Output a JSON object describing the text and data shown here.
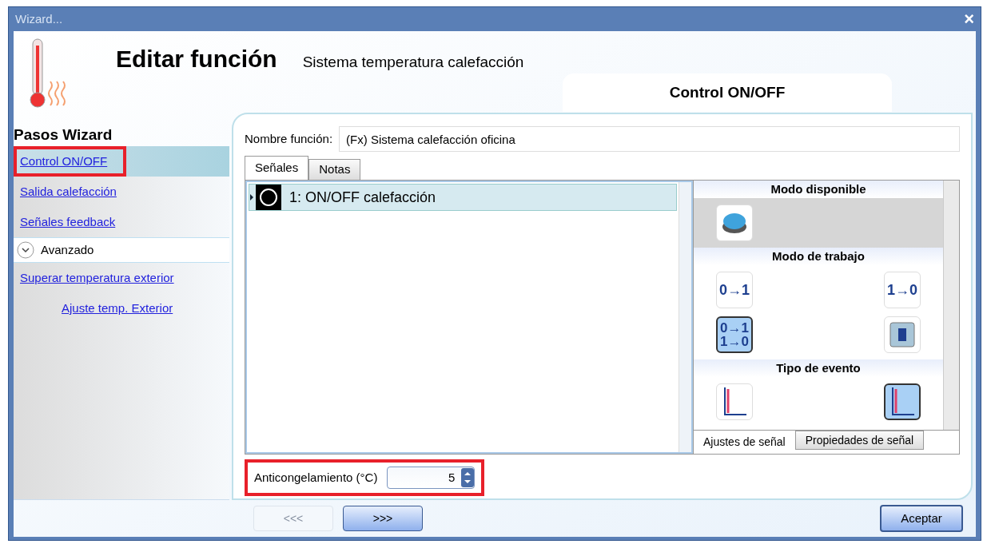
{
  "window": {
    "title": "Wizard...",
    "close": "×"
  },
  "header": {
    "title": "Editar función",
    "subtitle": "Sistema temperatura calefacción",
    "tab": "Control ON/OFF"
  },
  "sidebar": {
    "title": "Pasos Wizard",
    "items": [
      {
        "kind": "link",
        "label": "Control ON/OFF",
        "selected": true,
        "annotated": true
      },
      {
        "kind": "link",
        "label": "Salida calefacción",
        "selected": false
      },
      {
        "kind": "link",
        "label": "Señales feedback",
        "selected": false
      },
      {
        "kind": "group",
        "label": "Avanzado",
        "expanded": true,
        "selected": false
      },
      {
        "kind": "link",
        "label": "Superar temperatura exterior",
        "selected": false
      },
      {
        "kind": "sublink",
        "label": "Ajuste temp. Exterior",
        "selected": false
      }
    ]
  },
  "name_field": {
    "label": "Nombre función:",
    "value": "(Fx) Sistema calefacción oficina"
  },
  "tabs": [
    {
      "label": "Señales",
      "selected": true
    },
    {
      "label": "Notas",
      "selected": false
    }
  ],
  "signals": [
    {
      "label": "1: ON/OFF calefacción",
      "selected": true
    }
  ],
  "settings": {
    "sections": [
      {
        "title": "Modo disponible",
        "shaded": true,
        "options": [
          {
            "kind": "pushbutton",
            "selected": false
          }
        ]
      },
      {
        "title": "Modo de trabajo",
        "shaded": false,
        "options": [
          {
            "kind": "text",
            "text": "0→1",
            "selected": false
          },
          {
            "kind": "text",
            "text": "1→0",
            "selected": false
          },
          {
            "kind": "text2",
            "text": "0→1",
            "text2": "1→0",
            "selected": true
          },
          {
            "kind": "switch",
            "selected": false
          }
        ]
      },
      {
        "title": "Tipo de evento",
        "shaded": false,
        "options": [
          {
            "kind": "pulse",
            "selected": false
          },
          {
            "kind": "pulse",
            "selected": true
          }
        ]
      }
    ],
    "tabs": [
      {
        "label": "Ajustes de señal",
        "selected": true
      },
      {
        "label": "Propiedades de señal",
        "selected": false
      }
    ]
  },
  "antifreeze": {
    "label": "Anticongelamiento (°C)",
    "value": "5",
    "annotated": true
  },
  "buttons": [
    {
      "label": "<<<",
      "disabled": true
    },
    {
      "label": ">>>",
      "disabled": false
    }
  ],
  "accept": {
    "label": "Aceptar"
  }
}
